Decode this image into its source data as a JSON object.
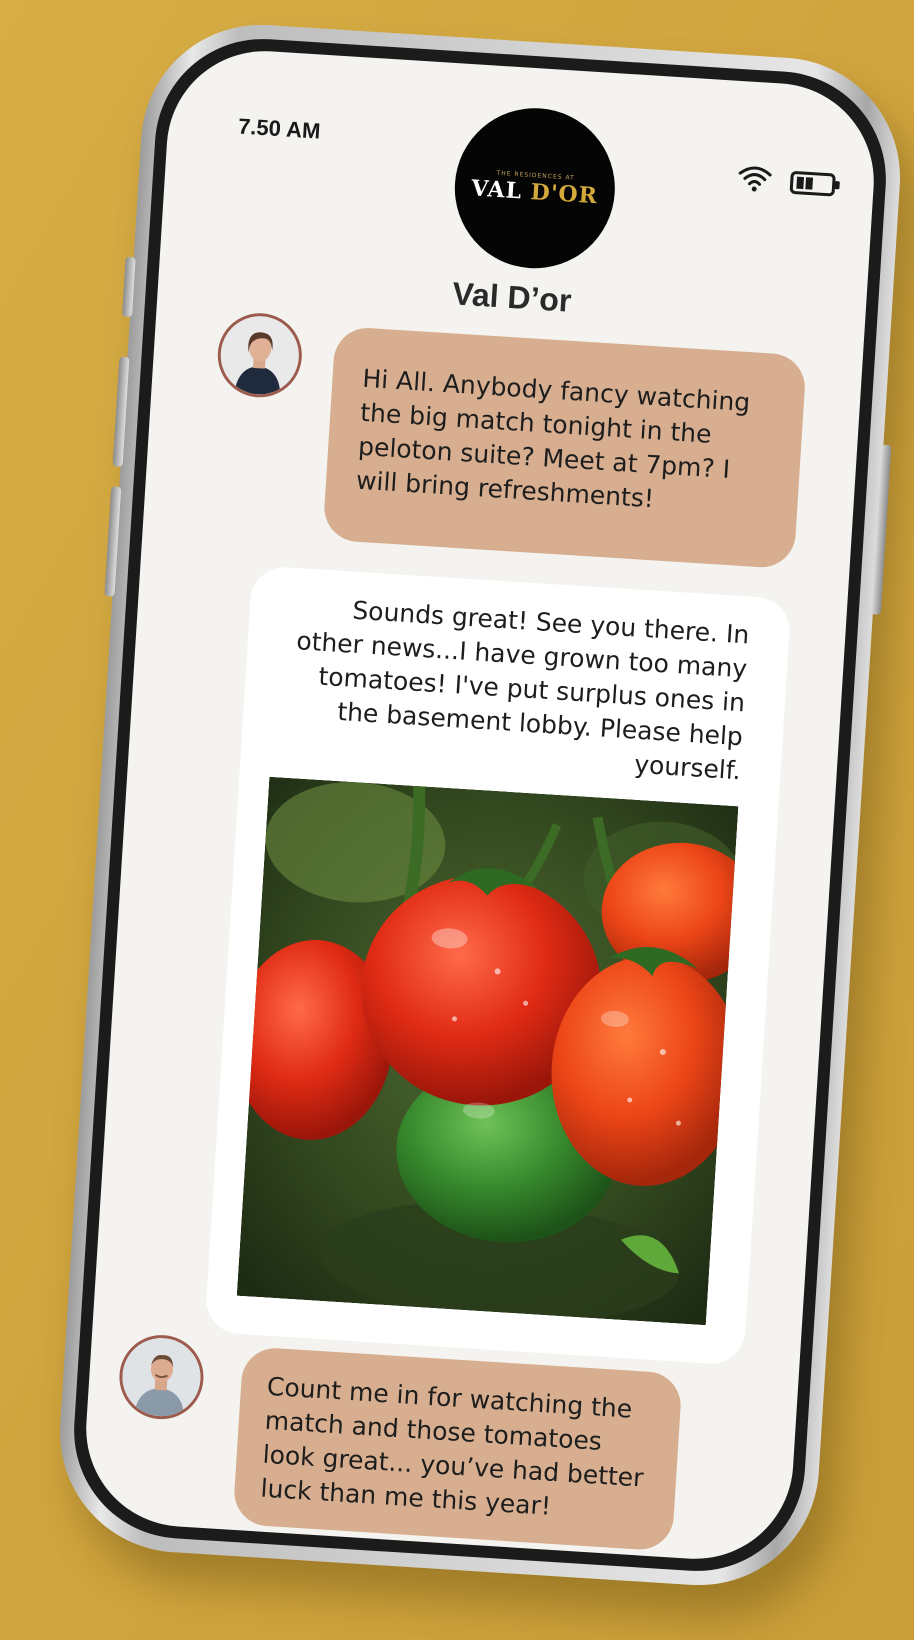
{
  "status_bar": {
    "time": "7.50 AM",
    "wifi_icon": "wifi-icon",
    "battery_icon": "battery-icon"
  },
  "logo": {
    "small_text": "THE RESIDENCES AT",
    "main_text_a": "VAL ",
    "main_text_b": "D'OR"
  },
  "chat": {
    "title": "Val D’or",
    "messages": [
      {
        "text": "Hi All. Anybody fancy watching the big match tonight in the peloton suite? Meet at 7pm? I will bring refreshments!",
        "bubble_color": "#d7ae8f"
      },
      {
        "text": "Sounds great! See you there. In other news...I have grown too many tomatoes! I've put surplus ones in the basement lobby. Please help yourself.",
        "bubble_color": "#ffffff",
        "image": "tomatoes-on-vine-photo"
      },
      {
        "text": "Count me in for watching the match and those tomatoes look great... you’ve had better luck than me this year!",
        "bubble_color": "#d7ae8f"
      }
    ]
  },
  "colors": {
    "background": "#cfa43f",
    "screen": "#f4f3f0",
    "bubble_tan": "#d7ae8f",
    "avatar_ring": "#9c5b4d"
  }
}
